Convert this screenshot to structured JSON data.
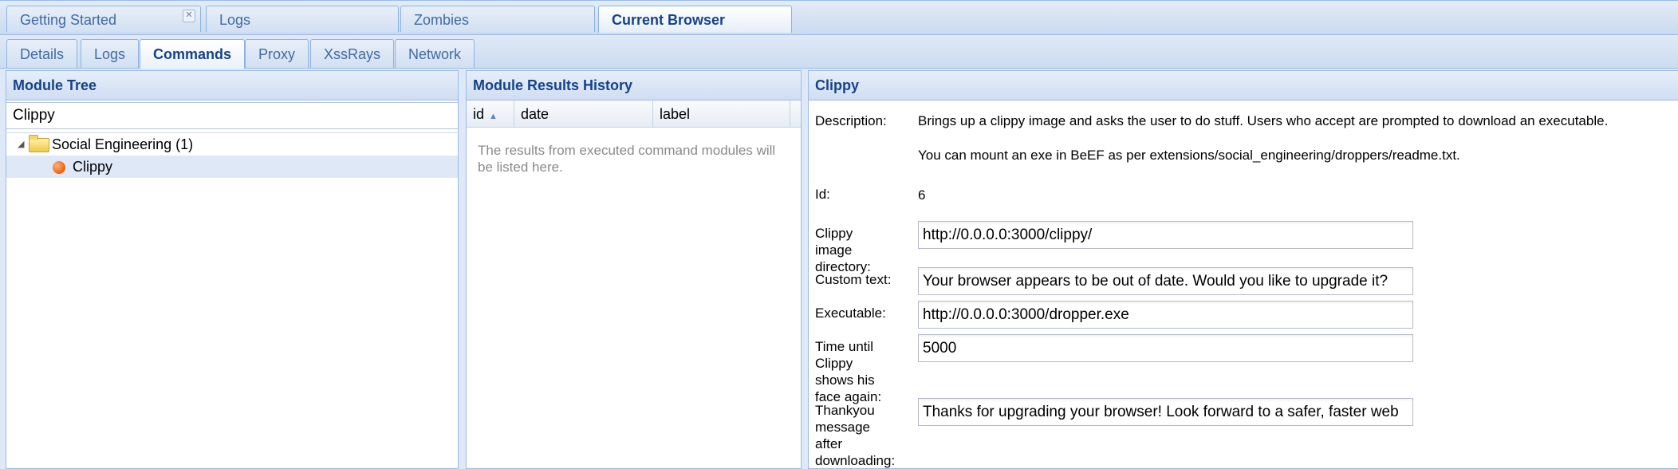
{
  "top_tabs": [
    {
      "label": "Getting Started"
    },
    {
      "label": "Logs"
    },
    {
      "label": "Zombies"
    },
    {
      "label": "Current Browser"
    }
  ],
  "sub_tabs": [
    {
      "label": "Details"
    },
    {
      "label": "Logs"
    },
    {
      "label": "Commands"
    },
    {
      "label": "Proxy"
    },
    {
      "label": "XssRays"
    },
    {
      "label": "Network"
    }
  ],
  "module_tree": {
    "title": "Module Tree",
    "search_value": "Clippy",
    "category": "Social Engineering (1)",
    "module": "Clippy"
  },
  "results_history": {
    "title": "Module Results History",
    "columns": [
      "id",
      "date",
      "label"
    ],
    "empty_text": "The results from executed command modules will be listed here."
  },
  "module_panel": {
    "title": "Clippy",
    "description_label": "Description:",
    "description_1": "Brings up a clippy image and asks the user to do stuff. Users who accept are prompted to download an executable.",
    "description_2": "You can mount an exe in BeEF as per extensions/social_engineering/droppers/readme.txt.",
    "id_label": "Id:",
    "id_value": "6",
    "fields": [
      {
        "label": "Clippy image directory:",
        "value": "http://0.0.0.0:3000/clippy/"
      },
      {
        "label": "Custom text:",
        "value": "Your browser appears to be out of date. Would you like to upgrade it?"
      },
      {
        "label": "Executable:",
        "value": "http://0.0.0.0:3000/dropper.exe"
      },
      {
        "label": "Time until Clippy shows his face again:",
        "value": "5000"
      },
      {
        "label": "Thankyou message after downloading:",
        "value": "Thanks for upgrading your browser! Look forward to a safer, faster web"
      }
    ]
  }
}
